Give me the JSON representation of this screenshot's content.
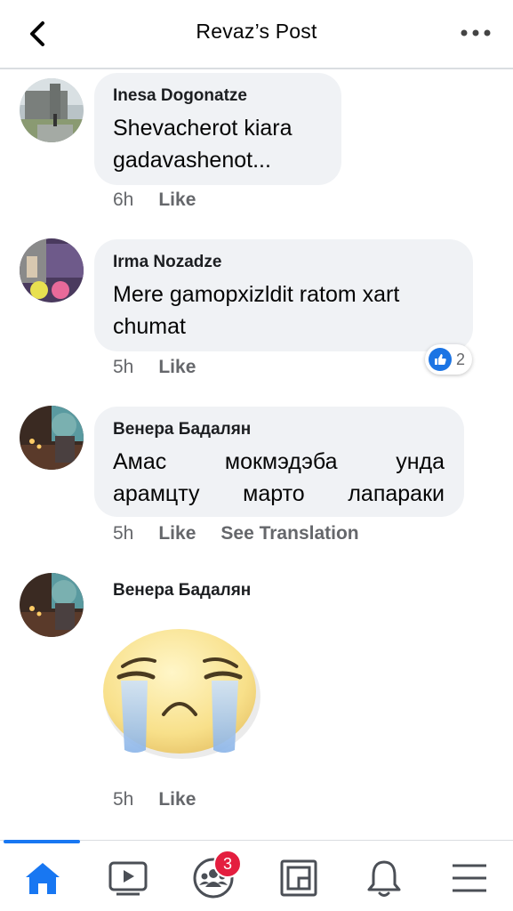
{
  "header": {
    "title": "Revaz’s Post"
  },
  "comments": [
    {
      "author": "Inesa Dogonatze",
      "text_lines": [
        "Shevacherot kiara",
        "gadavashenot..."
      ],
      "time": "6h",
      "actions": [
        "Like"
      ]
    },
    {
      "author": "Irma Nozadze",
      "text_lines": [
        "Mere gamopxizldit ratom xart",
        "chumat"
      ],
      "time": "5h",
      "actions": [
        "Like"
      ],
      "reaction_count": "2"
    },
    {
      "author": "Венера Бадалян",
      "text_lines": [
        "Амас мокмэдэба унда",
        "арамцту марто лапараки"
      ],
      "time": "5h",
      "actions": [
        "Like",
        "See Translation"
      ]
    },
    {
      "author": "Венера Бадалян",
      "sticker": "crying-face-sticker",
      "time": "5h",
      "actions": [
        "Like"
      ]
    }
  ],
  "bottom_nav": {
    "items": [
      "home-icon",
      "watch-icon",
      "groups-icon",
      "pages-icon",
      "notifications-icon",
      "menu-icon"
    ],
    "groups_badge": "3"
  },
  "colors": {
    "accent": "#1877f2",
    "bubble": "#f0f2f5",
    "meta": "#65676b",
    "badge": "#e41e3f"
  }
}
